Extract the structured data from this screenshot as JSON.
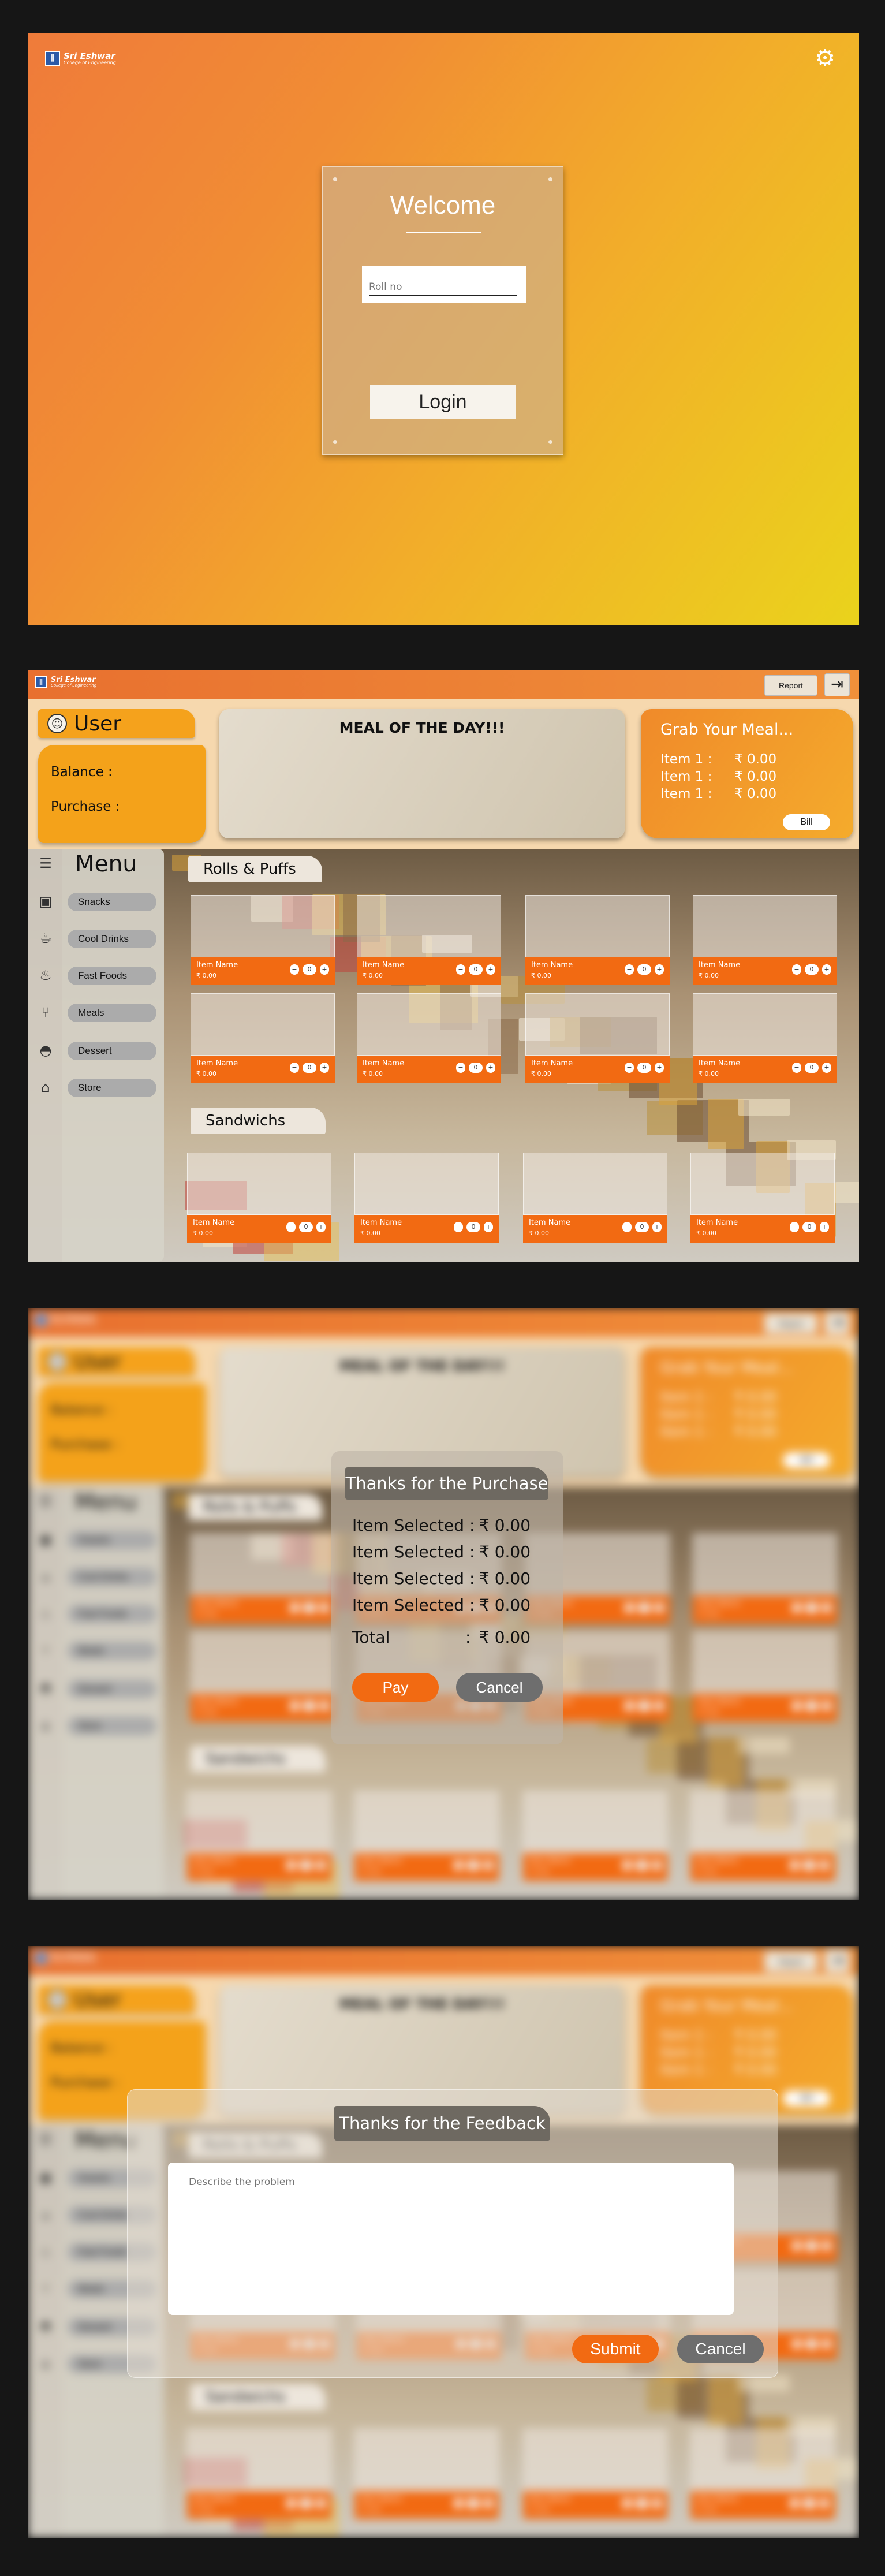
{
  "brand": {
    "name": "Sri Eshwar",
    "subtitle": "College of Engineering"
  },
  "login": {
    "welcome": "Welcome",
    "roll_placeholder": "Roll no",
    "login_label": "Login",
    "settings_icon": "gear-icon"
  },
  "header": {
    "report_label": "Report",
    "logout_icon": "logout-icon"
  },
  "user": {
    "title": "User",
    "balance_label": "Balance :",
    "purchase_label": "Purchase :"
  },
  "meal_of_day": {
    "title": "MEAL OF THE DAY!!!"
  },
  "grab_meal": {
    "title": "Grab Your Meal...",
    "rows": [
      {
        "label": "Item 1 :",
        "value": "₹  0.00"
      },
      {
        "label": "Item 1 :",
        "value": "₹  0.00"
      },
      {
        "label": "Item 1 :",
        "value": "₹  0.00"
      }
    ],
    "bill_label": "Bill"
  },
  "menu": {
    "title": "Menu",
    "items": [
      "Snacks",
      "Cool Drinks",
      "Fast Foods",
      "Meals",
      "Dessert",
      "Store"
    ]
  },
  "categories": [
    {
      "name": "Rolls & Puffs"
    },
    {
      "name": "Sandwichs"
    }
  ],
  "item_card": {
    "name": "Item Name",
    "price": "₹ 0.00",
    "qty": "0"
  },
  "purchase_modal": {
    "title": "Thanks for the Purchase",
    "rows": [
      {
        "label": "Item Selected",
        "sep": ":",
        "value": "₹  0.00"
      },
      {
        "label": "Item Selected",
        "sep": ":",
        "value": "₹  0.00"
      },
      {
        "label": "Item Selected",
        "sep": ":",
        "value": "₹  0.00"
      },
      {
        "label": "Item Selected",
        "sep": ":",
        "value": "₹  0.00"
      }
    ],
    "total": {
      "label": "Total",
      "sep": ":",
      "value": "₹  0.00"
    },
    "pay_label": "Pay",
    "cancel_label": "Cancel"
  },
  "feedback_modal": {
    "title": "Thanks for the Feedback",
    "placeholder": "Describe the problem",
    "submit_label": "Submit",
    "cancel_label": "Cancel"
  },
  "colors": {
    "accent": "#f26a12",
    "user_panel": "#f4a21a",
    "modal_title_bg": "#6e6961",
    "page_bg": "#161616"
  }
}
